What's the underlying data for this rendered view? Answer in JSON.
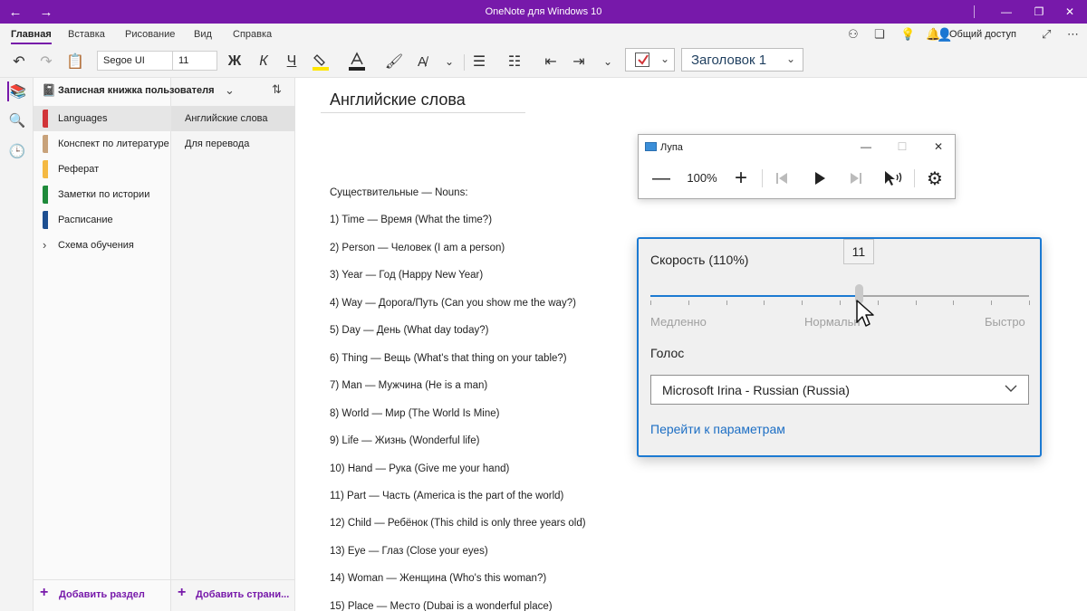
{
  "window": {
    "title": "OneNote для Windows 10"
  },
  "tabs": [
    "Главная",
    "Вставка",
    "Рисование",
    "Вид",
    "Справка"
  ],
  "ribbon": {
    "share_label": "Общий доступ",
    "font_name": "Segoe UI",
    "font_size": "11",
    "bold_label": "Ж",
    "italic_label": "К",
    "underline_label": "Ч",
    "style_value": "Заголовок 1"
  },
  "notebook": {
    "title": "Записная книжка пользователя",
    "sections": [
      {
        "label": "Languages",
        "color": "#d13438"
      },
      {
        "label": "Конспект по литературе",
        "color": "#c8a27a"
      },
      {
        "label": "Реферат",
        "color": "#f4b942"
      },
      {
        "label": "Заметки по истории",
        "color": "#1e8a3a"
      },
      {
        "label": "Расписание",
        "color": "#1d4f91"
      }
    ],
    "group": {
      "label": "Схема обучения",
      "chevron": "›"
    },
    "add_section": "Добавить раздел"
  },
  "pages": {
    "items": [
      "Английские слова",
      "Для перевода"
    ],
    "add_page": "Добавить страни..."
  },
  "page": {
    "title": "Английские слова",
    "lines": [
      "Существительные — Nouns:",
      "1) Time — Время (What the time?)",
      "2) Person — Человек (I am a person)",
      "3) Year — Год (Happy New Year)",
      "4) Way — Дорога/Путь (Can you show me the way?)",
      "5) Day — День (What day today?)",
      "6) Thing — Вещь (What's that thing on your table?)",
      "7) Man — Мужчина (He is a man)",
      "8) World — Мир (The World Is Mine)",
      "9) Life — Жизнь (Wonderful life)",
      "10) Hand — Рука (Give me your hand)",
      "11) Part — Часть (America is the part of the world)",
      "12) Child — Ребёнок (This child is only three years old)",
      "13) Eye — Глаз (Close your eyes)",
      "14) Woman — Женщина (Who's this woman?)",
      "15) Place — Место (Dubai is a wonderful place)"
    ]
  },
  "magnifier": {
    "title": "Лупа",
    "zoom": "100%"
  },
  "speed_panel": {
    "label": "Скорость (110%)",
    "tooltip_value": "11",
    "slider_level": 11,
    "slider_max": 20,
    "min_label": "Медленно",
    "mid_label": "Нормальн",
    "max_label": "Быстро",
    "voice_label": "Голос",
    "voice_value": "Microsoft Irina - Russian (Russia)",
    "settings_link": "Перейти к параметрам"
  },
  "colors": {
    "accent": "#7719aa",
    "link_blue": "#1c6ec4",
    "slider_blue": "#1c7ad2"
  }
}
